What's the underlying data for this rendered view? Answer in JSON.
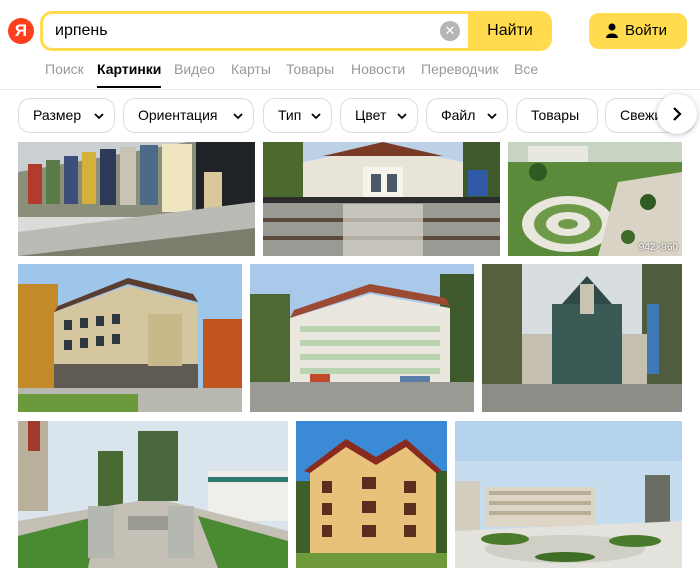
{
  "header": {
    "logo_letter": "Я",
    "search": {
      "value": "ирпень",
      "clear_glyph": "✕",
      "submit_label": "Найти"
    },
    "login_label": "Войти"
  },
  "tabs": [
    {
      "label": "Поиск",
      "active": false
    },
    {
      "label": "Картинки",
      "active": true
    },
    {
      "label": "Видео",
      "active": false
    },
    {
      "label": "Карты",
      "active": false
    },
    {
      "label": "Товары",
      "active": false
    },
    {
      "label": "Новости",
      "active": false
    },
    {
      "label": "Переводчик",
      "active": false
    },
    {
      "label": "Все",
      "active": false
    }
  ],
  "filters": [
    {
      "label": "Размер",
      "dropdown": true
    },
    {
      "label": "Ориентация",
      "dropdown": true
    },
    {
      "label": "Тип",
      "dropdown": true
    },
    {
      "label": "Цвет",
      "dropdown": true
    },
    {
      "label": "Файл",
      "dropdown": true
    },
    {
      "label": "Товары",
      "dropdown": false
    },
    {
      "label": "Свежие",
      "dropdown": false
    }
  ],
  "images": [
    {
      "name": "image-colorful-townhouses",
      "badge": ""
    },
    {
      "name": "image-railway-station",
      "badge": ""
    },
    {
      "name": "image-park-aerial",
      "badge": "942×960"
    },
    {
      "name": "image-residential-building-autumn",
      "badge": ""
    },
    {
      "name": "image-apartment-complex",
      "badge": ""
    },
    {
      "name": "image-tower-building-forest",
      "badge": ""
    },
    {
      "name": "image-pedestrian-alley",
      "badge": ""
    },
    {
      "name": "image-chalet-house",
      "badge": ""
    },
    {
      "name": "image-city-square",
      "badge": ""
    }
  ],
  "colors": {
    "brand_red": "#fc3f1d",
    "accent_yellow": "#ffdb4d",
    "inactive_text": "#999999"
  }
}
